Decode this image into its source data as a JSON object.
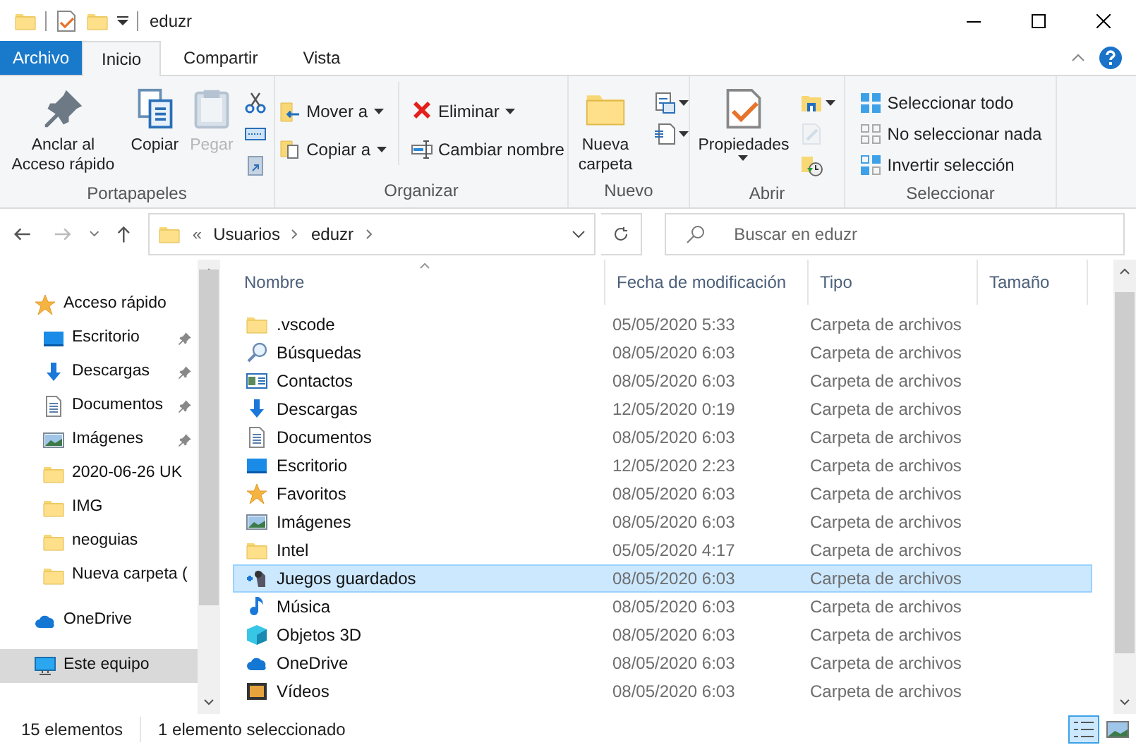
{
  "window": {
    "title": "eduzr"
  },
  "ribbon_tabs": [
    {
      "label": "Archivo",
      "kind": "file",
      "selected": false
    },
    {
      "label": "Inicio",
      "kind": "tab",
      "selected": true
    },
    {
      "label": "Compartir",
      "kind": "tab",
      "selected": false
    },
    {
      "label": "Vista",
      "kind": "tab",
      "selected": false
    }
  ],
  "ribbon_groups": [
    {
      "label": "Portapapeles",
      "items": [
        {
          "label": "Anclar al Acceso rápido",
          "kind": "large",
          "disabled": false
        },
        {
          "label": "Copiar",
          "kind": "large",
          "disabled": false
        },
        {
          "label": "Pegar",
          "kind": "large",
          "disabled": true
        },
        {
          "kind": "icon",
          "disabled": false
        },
        {
          "kind": "icon",
          "disabled": false
        },
        {
          "kind": "icon",
          "disabled": false
        }
      ]
    },
    {
      "label": "Organizar",
      "items": [
        {
          "label": "Mover a",
          "kind": "small",
          "disabled": false,
          "dropdown": true
        },
        {
          "label": "Copiar a",
          "kind": "small",
          "disabled": false,
          "dropdown": true
        },
        {
          "label": "Eliminar",
          "kind": "small",
          "disabled": false,
          "dropdown": true
        },
        {
          "label": "Cambiar nombre",
          "kind": "small",
          "disabled": false,
          "dropdown": false
        }
      ]
    },
    {
      "label": "Nuevo",
      "items": [
        {
          "label": "Nueva carpeta",
          "kind": "large",
          "disabled": false,
          "dropdown": false
        },
        {
          "kind": "icon",
          "disabled": false,
          "dropdown": true
        },
        {
          "kind": "icon",
          "disabled": false,
          "dropdown": true
        }
      ]
    },
    {
      "label": "Abrir",
      "items": [
        {
          "label": "Propiedades",
          "kind": "large",
          "disabled": false,
          "dropdown": true
        },
        {
          "kind": "icon",
          "disabled": false,
          "dropdown": true
        },
        {
          "kind": "icon",
          "disabled": true,
          "dropdown": false
        },
        {
          "kind": "icon",
          "disabled": false,
          "dropdown": false
        }
      ]
    },
    {
      "label": "Seleccionar",
      "items": [
        {
          "label": "Seleccionar todo",
          "kind": "small",
          "disabled": false
        },
        {
          "label": "No seleccionar nada",
          "kind": "small",
          "disabled": false
        },
        {
          "label": "Invertir selección",
          "kind": "small",
          "disabled": false
        }
      ]
    }
  ],
  "address": {
    "separator": "«",
    "path": [
      "Usuarios",
      "eduzr"
    ]
  },
  "search": {
    "placeholder": "Buscar en eduzr"
  },
  "sidebar": [
    {
      "label": "Acceso rápido",
      "kind": "star",
      "selected": false,
      "children": [
        {
          "label": "Escritorio",
          "kind": "desktop",
          "pinned": true,
          "selected": false
        },
        {
          "label": "Descargas",
          "kind": "download",
          "pinned": true,
          "selected": false
        },
        {
          "label": "Documentos",
          "kind": "document",
          "pinned": true,
          "selected": false
        },
        {
          "label": "Imágenes",
          "kind": "pictures",
          "pinned": true,
          "selected": false
        },
        {
          "label": "2020-06-26 UK",
          "kind": "folder",
          "pinned": false,
          "selected": false
        },
        {
          "label": "IMG",
          "kind": "folder",
          "pinned": false,
          "selected": false
        },
        {
          "label": "neoguias",
          "kind": "folder",
          "pinned": false,
          "selected": false
        },
        {
          "label": "Nueva carpeta (",
          "kind": "folder",
          "pinned": false,
          "selected": false
        }
      ]
    },
    {
      "label": "OneDrive",
      "kind": "cloud",
      "selected": false
    },
    {
      "label": "Este equipo",
      "kind": "computer",
      "selected": true
    }
  ],
  "table": {
    "columns": [
      {
        "label": "Nombre",
        "sorted": true
      },
      {
        "label": "Fecha de modificación",
        "sorted": false
      },
      {
        "label": "Tipo",
        "sorted": false
      },
      {
        "label": "Tamaño",
        "sorted": false
      }
    ],
    "rows": [
      {
        "name": ".vscode",
        "kind": "folder",
        "date": "05/05/2020 5:33",
        "type": "Carpeta de archivos",
        "selected": false
      },
      {
        "name": "Búsquedas",
        "kind": "search",
        "date": "08/05/2020 6:03",
        "type": "Carpeta de archivos",
        "selected": false
      },
      {
        "name": "Contactos",
        "kind": "contacts",
        "date": "08/05/2020 6:03",
        "type": "Carpeta de archivos",
        "selected": false
      },
      {
        "name": "Descargas",
        "kind": "download",
        "date": "12/05/2020 0:19",
        "type": "Carpeta de archivos",
        "selected": false
      },
      {
        "name": "Documentos",
        "kind": "document",
        "date": "08/05/2020 6:03",
        "type": "Carpeta de archivos",
        "selected": false
      },
      {
        "name": "Escritorio",
        "kind": "desktop",
        "date": "12/05/2020 2:23",
        "type": "Carpeta de archivos",
        "selected": false
      },
      {
        "name": "Favoritos",
        "kind": "star",
        "date": "08/05/2020 6:03",
        "type": "Carpeta de archivos",
        "selected": false
      },
      {
        "name": "Imágenes",
        "kind": "pictures",
        "date": "08/05/2020 6:03",
        "type": "Carpeta de archivos",
        "selected": false
      },
      {
        "name": "Intel",
        "kind": "folder",
        "date": "05/05/2020 4:17",
        "type": "Carpeta de archivos",
        "selected": false
      },
      {
        "name": "Juegos guardados",
        "kind": "games",
        "date": "08/05/2020 6:03",
        "type": "Carpeta de archivos",
        "selected": true
      },
      {
        "name": "Música",
        "kind": "music",
        "date": "08/05/2020 6:03",
        "type": "Carpeta de archivos",
        "selected": false
      },
      {
        "name": "Objetos 3D",
        "kind": "objects3d",
        "date": "08/05/2020 6:03",
        "type": "Carpeta de archivos",
        "selected": false
      },
      {
        "name": "OneDrive",
        "kind": "cloud",
        "date": "08/05/2020 6:03",
        "type": "Carpeta de archivos",
        "selected": false
      },
      {
        "name": "Vídeos",
        "kind": "video",
        "date": "08/05/2020 6:03",
        "type": "Carpeta de archivos",
        "selected": false
      }
    ]
  },
  "status_bar": {
    "count": "15 elementos",
    "selection": "1 elemento seleccionado",
    "views": [
      {
        "kind": "details",
        "selected": true
      },
      {
        "kind": "tiles",
        "selected": false
      }
    ]
  }
}
